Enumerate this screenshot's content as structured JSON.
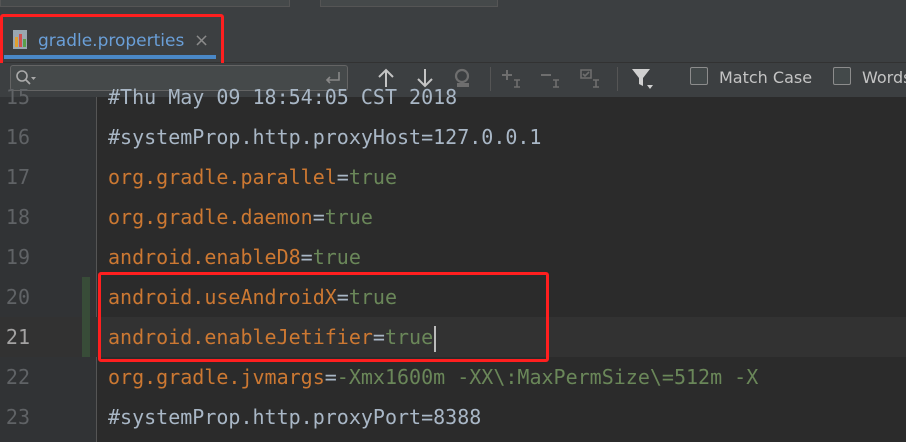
{
  "tab": {
    "label": "gradle.properties",
    "close": "×"
  },
  "find": {
    "placeholder": "",
    "match_case": "Match Case",
    "words": "Words"
  },
  "lines": [
    {
      "num": "15",
      "key": "",
      "sep": "",
      "val": "",
      "comment": "#Thu May 09 18:54:05 CST 2018"
    },
    {
      "num": "16",
      "key": "",
      "sep": "",
      "val": "",
      "comment": "#systemProp.http.proxyHost=127.0.0.1"
    },
    {
      "num": "17",
      "key": "org.gradle.parallel",
      "sep": "=",
      "val": "true",
      "comment": ""
    },
    {
      "num": "18",
      "key": "org.gradle.daemon",
      "sep": "=",
      "val": "true",
      "comment": ""
    },
    {
      "num": "19",
      "key": "android.enableD8",
      "sep": "=",
      "val": "true",
      "comment": ""
    },
    {
      "num": "20",
      "key": "android.useAndroidX",
      "sep": "=",
      "val": "true",
      "comment": ""
    },
    {
      "num": "21",
      "key": "android.enableJetifier",
      "sep": "=",
      "val": "true",
      "comment": ""
    },
    {
      "num": "22",
      "key": "org.gradle.jvmargs",
      "sep": "=",
      "val": "-Xmx1600m -XX\\:MaxPermSize\\=512m -X",
      "comment": ""
    },
    {
      "num": "23",
      "key": "",
      "sep": "",
      "val": "",
      "comment": "#systemProp.http.proxyPort=8388"
    }
  ],
  "colors": {
    "key": "#cc7832",
    "value": "#6a8759",
    "highlight": "#ff1f1f",
    "tab_accent": "#4a88c7"
  }
}
